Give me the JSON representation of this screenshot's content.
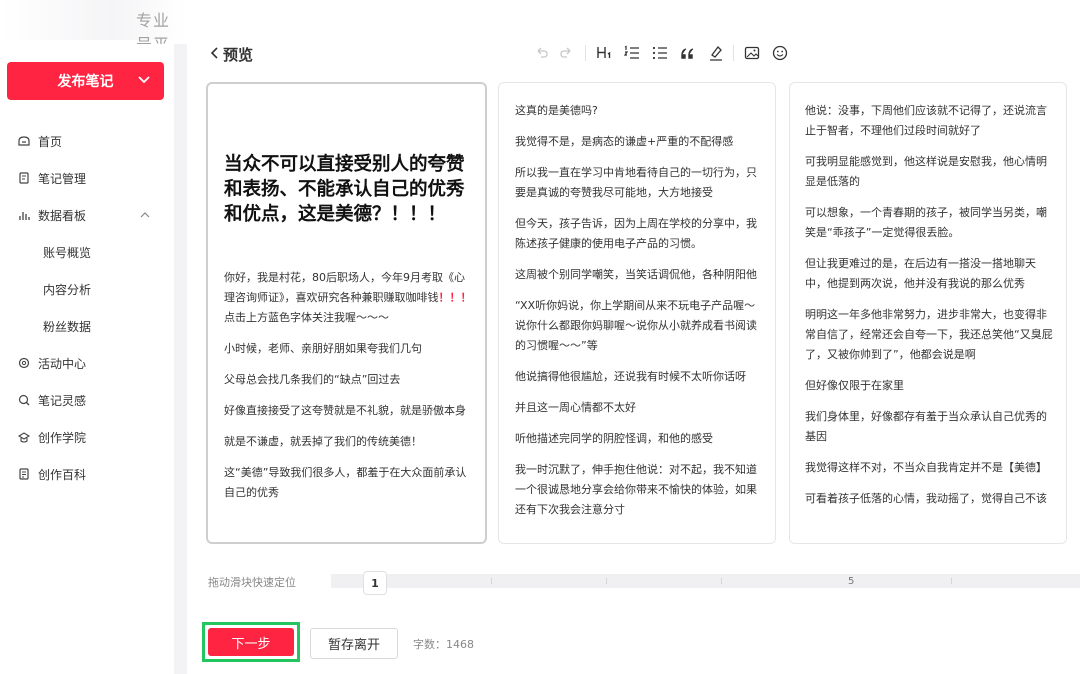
{
  "header": {
    "logo_text": "专业号平"
  },
  "sidebar": {
    "publish_label": "发布笔记",
    "items": [
      {
        "label": "首页",
        "icon": "home-icon"
      },
      {
        "label": "笔记管理",
        "icon": "note-icon"
      },
      {
        "label": "数据看板",
        "icon": "chart-icon"
      },
      {
        "label": "账号概览"
      },
      {
        "label": "内容分析"
      },
      {
        "label": "粉丝数据"
      },
      {
        "label": "活动中心",
        "icon": "activity-icon"
      },
      {
        "label": "笔记灵感",
        "icon": "inspiration-icon"
      },
      {
        "label": "创作学院",
        "icon": "academy-icon"
      },
      {
        "label": "创作百科",
        "icon": "wiki-icon"
      }
    ]
  },
  "preview": {
    "title": "预览",
    "toolbar": [
      "undo-icon",
      "redo-icon",
      "heading-icon",
      "ordered-list-icon",
      "bullet-list-icon",
      "quote-icon",
      "highlight-icon",
      "image-icon",
      "emoji-icon"
    ]
  },
  "cards": {
    "c1_title": "当众不可以直接受别人的夸赞和表扬、不能承认自己的优秀和优点，这是美德？！！！",
    "c1_paras": [
      "你好，我是村花，80后职场人，今年9月考取《心理咨询师证》，喜欢研究各种兼职赚取咖啡钱",
      "小时候，老师、亲朋好朋如果夸我们几句",
      "父母总会找几条我们的“缺点”回过去",
      "好像直接接受了这夸赞就是不礼貌，就是骄傲本身",
      "就是不谦虚，就丢掉了我们的传统美德！",
      "这“美德”导致我们很多人，都羞于在大众面前承认自己的优秀"
    ],
    "c1_red": "！！！",
    "c1_after_red": "点击上方蓝色字体关注我喔～～～",
    "c2_paras": [
      "这真的是美德吗?",
      "我觉得不是，是病态的谦虚+严重的不配得感",
      "所以我一直在学习中肯地看待自己的一切行为，只要是真诚的夸赞我尽可能地，大方地接受",
      "但今天，孩子告诉，因为上周在学校的分享中，我陈述孩子健康的使用电子产品的习惯。",
      "这周被个别同学嘲笑，当笑话调侃他，各种阴阳他",
      "“XX听你妈说，你上学期间从来不玩电子产品喔～说你什么都跟你妈聊喔～说你从小就养成看书阅读的习惯喔～～”等",
      "他说搞得他很尴尬，还说我有时候不太听你话呀",
      "并且这一周心情都不太好",
      "听他描述完同学的阴腔怪调，和他的感受",
      "我一时沉默了，伸手抱住他说：对不起，我不知道一个很诚恳地分享会给你带来不愉快的体验，如果还有下次我会注意分寸"
    ],
    "c3_paras": [
      "他说：没事，下周他们应该就不记得了，还说流言止于智者，不理他们过段时间就好了",
      "可我明显能感觉到，他这样说是安慰我，他心情明显是低落的",
      "可以想象，一个青春期的孩子，被同学当另类，嘲笑是“乖孩子”一定觉得很丢脸。",
      "但让我更难过的是，在后边有一搭没一搭地聊天中，他提到两次说，他并没有我说的那么优秀",
      "明明这一年多他非常努力，进步非常大，也变得非常自信了，经常还会自夸一下，我还总笑他“又臭屁了，又被你帅到了”，他都会说是啊",
      "但好像仅限于在家里",
      "我们身体里，好像都存有羞于当众承认自己优秀的基因",
      "我觉得这样不对，不当众自我肯定并不是【美德】",
      "可看着孩子低落的心情，我动摇了，觉得自己不该"
    ]
  },
  "slider": {
    "label": "拖动滑块快速定位",
    "current": "1",
    "max_label": "5"
  },
  "bottom": {
    "next_label": "下一步",
    "save_label": "暂存离开",
    "wordcount": "字数：1468"
  },
  "colors": {
    "accent": "#ff2442",
    "highlight_border": "#22c55e"
  }
}
